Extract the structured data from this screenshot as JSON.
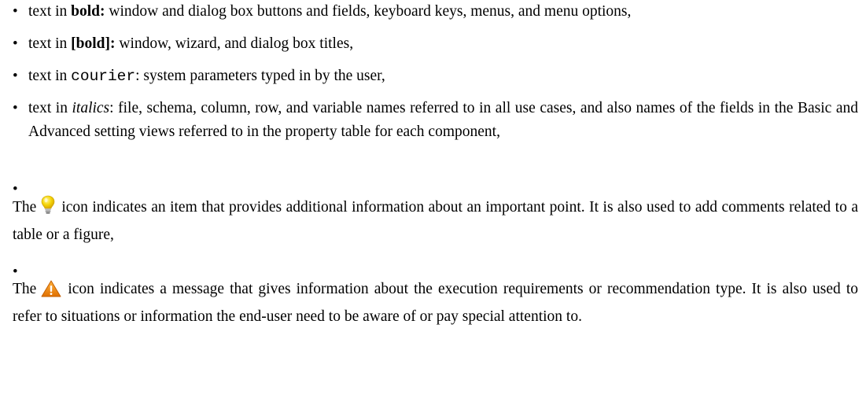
{
  "conventions": {
    "bold_item": {
      "prefix": "text in ",
      "emph": "bold:",
      "rest": " window and dialog box buttons and fields, keyboard keys, menus, and menu options,"
    },
    "bracket_bold_item": {
      "prefix": "text in ",
      "emph": "[bold]:",
      "rest": " window, wizard, and dialog box titles,"
    },
    "courier_item": {
      "prefix": "text in ",
      "emph": "courier",
      "rest": ": system parameters typed in by the user,"
    },
    "italics_item": {
      "prefix": "text in ",
      "emph": "italics",
      "rest": ": file, schema, column, row, and variable names referred to in all use cases, and also names of the fields in the Basic and Advanced setting views referred to in the property table for each component,"
    },
    "tip_item": {
      "prefix": "The",
      "icon": "lightbulb-icon",
      "rest": "icon indicates an item that provides additional information about an important point. It is also used to add comments related to a table or a figure,"
    },
    "warning_item": {
      "prefix": "The",
      "icon": "warning-triangle-icon",
      "rest": "icon indicates a message that gives information about the execution requirements or recommendation type. It is also used to refer to situations or information the end-user need to be aware of or pay special attention to."
    }
  },
  "bullet_char": "•",
  "colors": {
    "text": "#000000",
    "bulb_yellow": "#f5d60a",
    "warning_orange": "#f08a00"
  }
}
